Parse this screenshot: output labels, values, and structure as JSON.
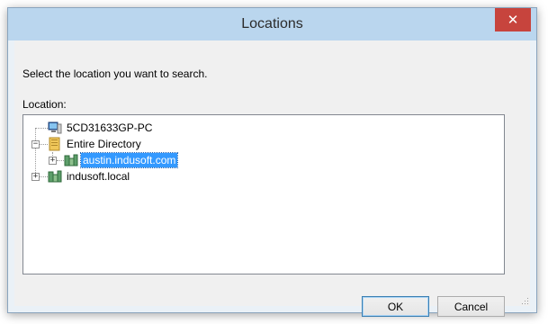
{
  "window": {
    "title": "Locations"
  },
  "instruction": "Select the location you want to search.",
  "location_label": "Location:",
  "tree": {
    "items": [
      {
        "label": "5CD31633GP-PC",
        "icon": "computer-icon",
        "expanded": null
      },
      {
        "label": "Entire Directory",
        "icon": "directory-icon",
        "expanded": true
      },
      {
        "label": "austin.indusoft.com",
        "icon": "domain-icon",
        "expanded": false,
        "selected": true
      },
      {
        "label": "indusoft.local",
        "icon": "domain-icon",
        "expanded": false
      }
    ]
  },
  "buttons": {
    "ok": "OK",
    "cancel": "Cancel"
  },
  "colors": {
    "titlebar": "#bad6ee",
    "close": "#c7443d",
    "selection": "#3399ff"
  }
}
